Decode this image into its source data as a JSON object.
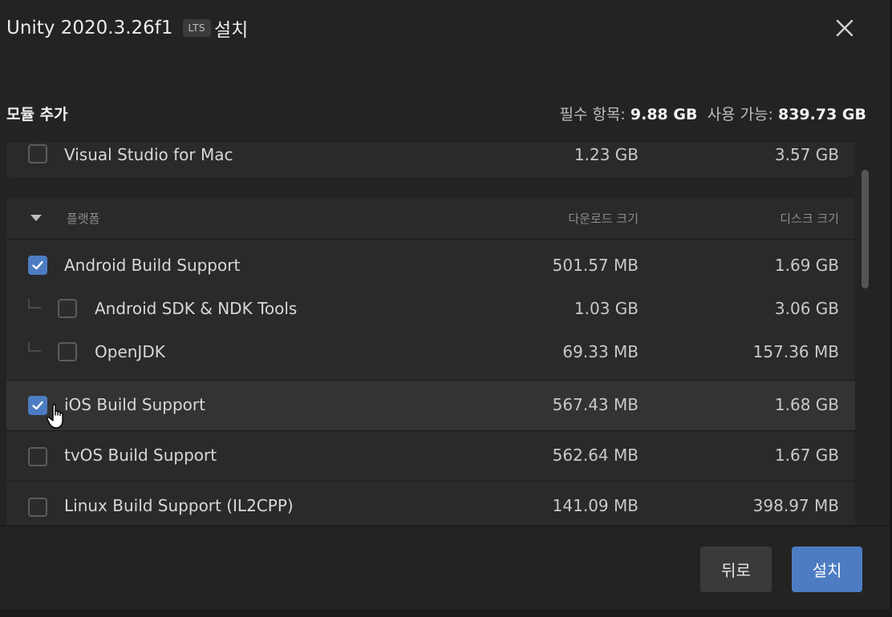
{
  "dialog": {
    "title_prefix": "Unity 2020.3.26f1",
    "lts_badge": "LTS",
    "title_suffix": "설치",
    "close_icon": "close-icon"
  },
  "modules": {
    "section_title": "모듈 추가",
    "required_label": "필수 항목:",
    "required_value": "9.88 GB",
    "available_label": "사용 가능:",
    "available_value": "839.73 GB"
  },
  "dev_tools": {
    "items": [
      {
        "name": "Visual Studio for Mac",
        "download": "1.23 GB",
        "disk": "3.57 GB",
        "checked": false
      }
    ]
  },
  "platforms": {
    "header": "플랫폼",
    "col_download": "다운로드 크기",
    "col_disk": "디스크 크기",
    "items": [
      {
        "name": "Android Build Support",
        "download": "501.57 MB",
        "disk": "1.69 GB",
        "checked": true
      },
      {
        "name": "Android SDK & NDK Tools",
        "download": "1.03 GB",
        "disk": "3.06 GB",
        "checked": false,
        "child": true
      },
      {
        "name": "OpenJDK",
        "download": "69.33 MB",
        "disk": "157.36 MB",
        "checked": false,
        "child": true
      },
      {
        "name": "iOS Build Support",
        "download": "567.43 MB",
        "disk": "1.68 GB",
        "checked": true
      },
      {
        "name": "tvOS Build Support",
        "download": "562.64 MB",
        "disk": "1.67 GB",
        "checked": false
      },
      {
        "name": "Linux Build Support (IL2CPP)",
        "download": "141.09 MB",
        "disk": "398.97 MB",
        "checked": false
      }
    ]
  },
  "footer": {
    "back_label": "뒤로",
    "install_label": "설치"
  },
  "colors": {
    "accent": "#4d7cc2",
    "background": "#232323"
  }
}
